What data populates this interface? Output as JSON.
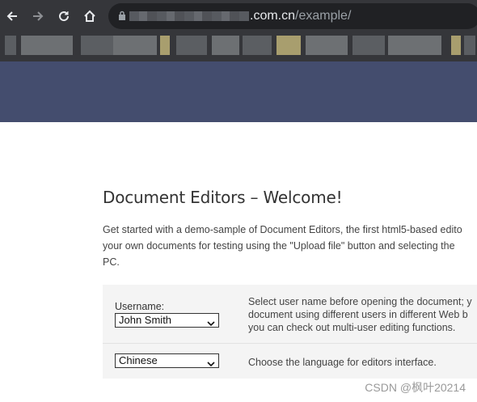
{
  "browser": {
    "url_domain": ".com.cn",
    "url_path": "/example/",
    "icons": [
      "back-arrow-icon",
      "forward-arrow-icon",
      "reload-icon",
      "home-icon",
      "lock-icon"
    ]
  },
  "colors": {
    "chrome_bg": "#35363a",
    "header_band": "#444d6e",
    "options_bg": "#f4f4f4"
  },
  "page": {
    "title": "Document Editors – Welcome!",
    "intro_lines": [
      "Get started with a demo-sample of Document Editors, the first html5-based edito",
      "your own documents for testing using the \"Upload file\" button and selecting the",
      "PC."
    ]
  },
  "options": {
    "username": {
      "label": "Username:",
      "selected": "John Smith",
      "description_lines": [
        "Select user name before opening the document; y",
        "document using different users in different Web b",
        "you can check out multi-user editing functions."
      ]
    },
    "language": {
      "selected": "Chinese",
      "description": "Choose the language for editors interface."
    }
  },
  "watermark": "CSDN @枫叶20214"
}
